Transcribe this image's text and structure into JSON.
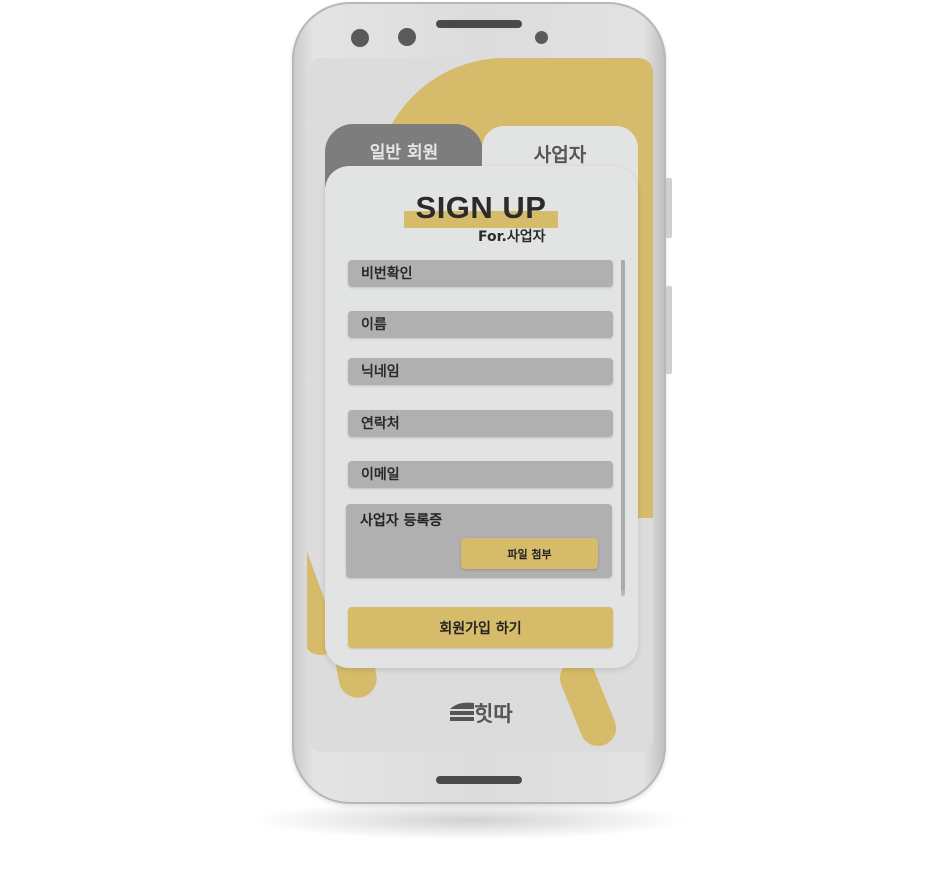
{
  "tabs": {
    "general_label": "일반 회원",
    "business_label": "사업자"
  },
  "header": {
    "title": "SIGN UP",
    "subtitle": "For.사업자"
  },
  "form": {
    "fields": [
      {
        "placeholder": "비번확인"
      },
      {
        "placeholder": "이름"
      },
      {
        "placeholder": "닉네임"
      },
      {
        "placeholder": "연락처"
      },
      {
        "placeholder": "이메일"
      }
    ],
    "business_registration_label": "사업자 등록증",
    "attach_button_label": "파일 첨부",
    "submit_label": "회원가입 하기"
  },
  "brand": {
    "logo_text": "힛따"
  },
  "colors": {
    "accent": "#d6bc6a",
    "field_bg": "#b0b0b0",
    "card_bg": "#e2e3e3",
    "inactive_tab": "#7d7d7d"
  }
}
